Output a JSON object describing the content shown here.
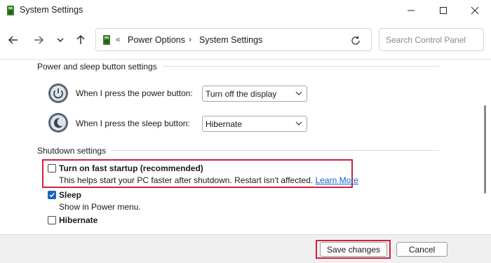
{
  "window": {
    "title": "System Settings"
  },
  "nav": {
    "breadcrumb": [
      "Power Options",
      "System Settings"
    ],
    "search_placeholder": "Search Control Panel"
  },
  "power_group": {
    "title": "Power and sleep button settings",
    "power_button_label": "When I press the power button:",
    "power_button_value": "Turn off the display",
    "sleep_button_label": "When I press the sleep button:",
    "sleep_button_value": "Hibernate"
  },
  "shutdown_group": {
    "title": "Shutdown settings",
    "fast_startup": {
      "label": "Turn on fast startup (recommended)",
      "description": "This helps start your PC faster after shutdown. Restart isn't affected.",
      "link": "Learn More",
      "checked": false
    },
    "sleep": {
      "label": "Sleep",
      "description": "Show in Power menu.",
      "checked": true
    },
    "hibernate": {
      "label": "Hibernate",
      "checked": false
    }
  },
  "footer": {
    "save_label": "Save changes",
    "cancel_label": "Cancel"
  },
  "colors": {
    "accent": "#1565c0",
    "highlight": "#d02040",
    "link": "#0b63ce"
  },
  "icons": [
    "app-icon",
    "minimize-icon",
    "maximize-icon",
    "close-icon",
    "back-arrow-icon",
    "forward-arrow-icon",
    "recent-locations-icon",
    "up-arrow-icon",
    "control-panel-icon",
    "refresh-icon",
    "power-button-icon",
    "sleep-button-icon",
    "checkmark-icon"
  ]
}
